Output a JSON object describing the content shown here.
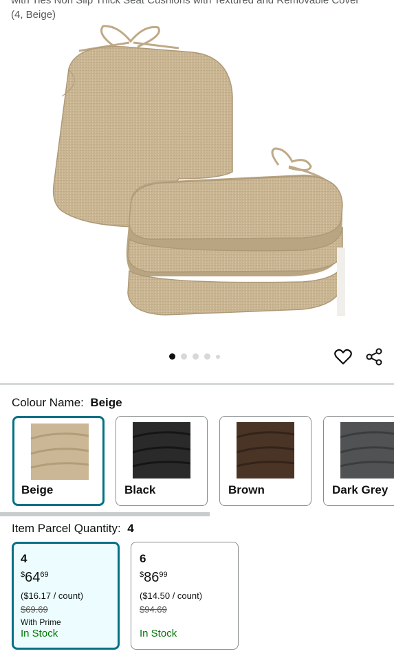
{
  "product": {
    "title_line1": "with Ties Non Slip Thick Seat Cushions with Textured and Removable Cover",
    "title_line2": "(4, Beige)"
  },
  "gallery": {
    "image_count": 5,
    "active_index": 0
  },
  "actions": {
    "wishlist_icon": "heart-icon",
    "share_icon": "share-icon"
  },
  "colour": {
    "label": "Colour Name:",
    "selected": "Beige",
    "options": [
      {
        "name": "Beige",
        "color": "#cbb795"
      },
      {
        "name": "Black",
        "color": "#2a2a2a"
      },
      {
        "name": "Brown",
        "color": "#4a3426"
      },
      {
        "name": "Dark Grey",
        "color": "#505254"
      }
    ]
  },
  "quantity": {
    "label": "Item Parcel Quantity:",
    "selected": "4",
    "options": [
      {
        "count": "4",
        "currency": "$",
        "price_whole": "64",
        "price_fraction": "69",
        "unit_price": "($16.17 / count)",
        "list_price": "$69.69",
        "prime": "With Prime",
        "stock": "In Stock"
      },
      {
        "count": "6",
        "currency": "$",
        "price_whole": "86",
        "price_fraction": "99",
        "unit_price": "($14.50 / count)",
        "list_price": "$94.69",
        "prime": "",
        "stock": "In Stock"
      }
    ]
  },
  "colors": {
    "accent": "#007185",
    "in_stock": "#007600",
    "selected_bg": "#edfdff"
  }
}
